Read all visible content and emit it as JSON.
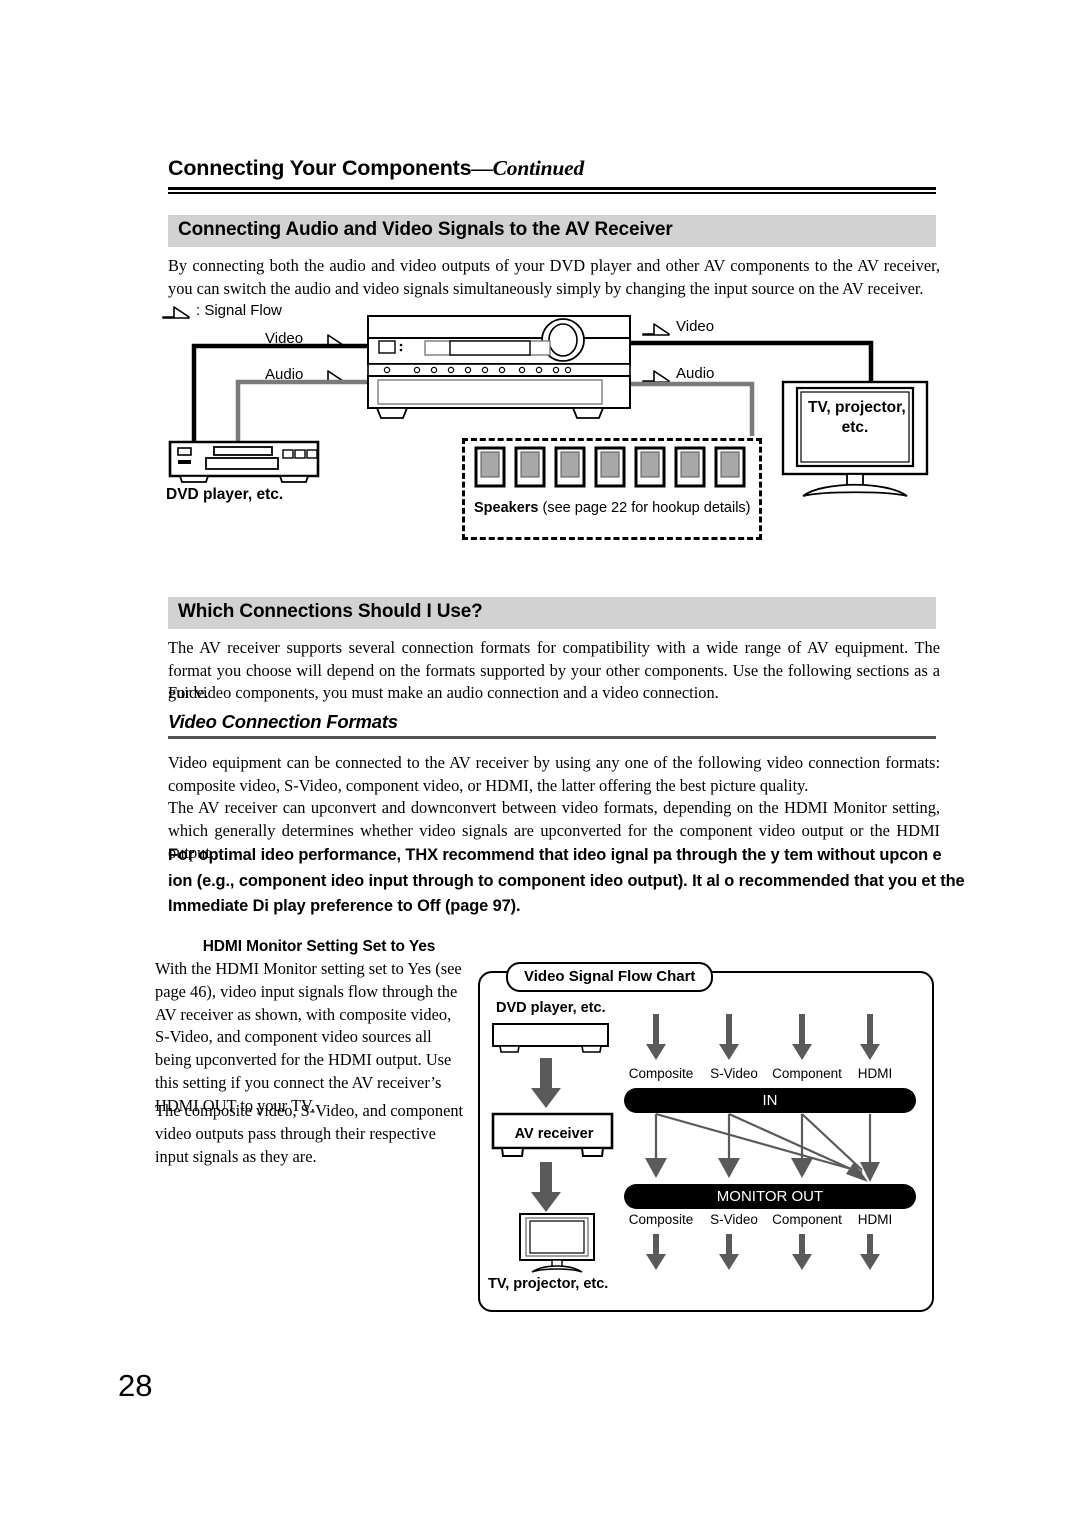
{
  "running_head": {
    "title": "Connecting Your Components",
    "dash": "—",
    "continued": "Continued"
  },
  "sections": {
    "audio_video": {
      "bar_title": "Connecting Audio and Video Signals to the AV Receiver",
      "intro": "By connecting both the audio and video outputs of your DVD player and other AV components to the AV receiver, you can switch the audio and video signals simultaneously simply by changing the input source on the AV receiver."
    },
    "which_connections": {
      "bar_title": "Which Connections Should I Use?",
      "p1": "The AV receiver supports several connection formats for compatibility with a wide range of AV equipment. The format you choose will depend on the formats supported by your other components. Use the following sections as a guide.",
      "p2": "For video components, you must make an audio connection and a video connection."
    },
    "video_formats": {
      "subhead": "Video Connection Formats",
      "p1": "Video equipment can be connected to the AV receiver by using any one of the following video connection formats: composite video, S-Video, component video, or HDMI, the latter offering the best picture quality.",
      "p2": "The AV receiver can upconvert and downconvert between video formats, depending on the HDMI Monitor setting, which generally determines whether video signals are upconverted for the component video output or the HDMI output.",
      "thx_lines": [
        "For optimal  ideo performance, THX recommend  that  ideo  ignal  pa   through the  y tem without upcon e",
        " ion (e.g., component  ideo input through to component  ideo output). It  al o recommended that you  et the",
        "Immediate Di  play preference to Off (page 97)."
      ]
    },
    "hdmi_yes": {
      "head": "HDMI Monitor Setting Set to Yes",
      "p1": "With the HDMI Monitor setting set to Yes (see page 46), video input signals flow through the AV receiver as shown, with composite video, S-Video, and component video sources all being upconverted for the HDMI output. Use this setting if you connect the AV receiver’s HDMI OUT to your TV.",
      "p2": "The composite video, S-Video, and component video outputs pass through their respective input signals as they are."
    }
  },
  "diagram_connection": {
    "legend": ": Signal Flow",
    "video_label_left": "Video",
    "audio_label_left": "Audio",
    "video_label_right": "Video",
    "audio_label_right": "Audio",
    "dvd_label": "DVD player, etc.",
    "tv_label_line1": "TV, projector,",
    "tv_label_line2": "etc.",
    "speakers_bold": "Speakers",
    "speakers_rest": " (see page 22 for hookup details)",
    "speaker_count": 7,
    "wire_video_color": "#000000",
    "wire_audio_color": "#7a7a7a"
  },
  "chart_data": {
    "type": "diagram",
    "title": "Video Signal Flow Chart",
    "nodes": [
      "DVD player, etc.",
      "AV receiver",
      "TV, projector, etc."
    ],
    "dvd_label": "DVD player, etc.",
    "receiver_label": "AV receiver",
    "tv_label": "TV, projector, etc.",
    "in_bar": "IN",
    "out_bar": "MONITOR OUT",
    "in_columns": [
      "Composite",
      "S-Video",
      "Component",
      "HDMI"
    ],
    "out_columns": [
      "Composite",
      "S-Video",
      "Component",
      "HDMI"
    ],
    "routes": [
      {
        "from": "Composite",
        "to": "Composite"
      },
      {
        "from": "Composite",
        "to": "HDMI"
      },
      {
        "from": "S-Video",
        "to": "S-Video"
      },
      {
        "from": "S-Video",
        "to": "HDMI"
      },
      {
        "from": "Component",
        "to": "Component"
      },
      {
        "from": "Component",
        "to": "HDMI"
      },
      {
        "from": "HDMI",
        "to": "HDMI"
      }
    ],
    "arrow_color": "#5a5a5a",
    "bar_color": "#000000"
  },
  "footer": {
    "page_number": "28"
  }
}
